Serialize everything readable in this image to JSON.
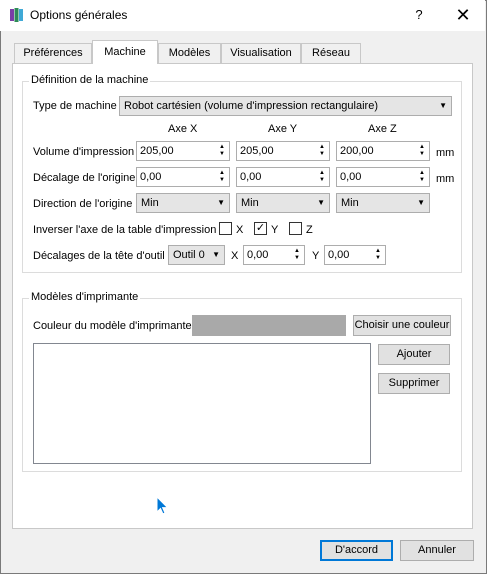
{
  "window": {
    "title": "Options générales",
    "help_label": "?",
    "close_label": "✕"
  },
  "tabs": [
    {
      "label": "Préférences"
    },
    {
      "label": "Machine"
    },
    {
      "label": "Modèles"
    },
    {
      "label": "Visualisation"
    },
    {
      "label": "Réseau"
    }
  ],
  "active_tab": "Machine",
  "machine": {
    "group_title": "Définition de la machine",
    "type_label": "Type de machine",
    "type_value": "Robot cartésien (volume d'impression rectangulaire)",
    "axis_headers": [
      "Axe X",
      "Axe Y",
      "Axe Z"
    ],
    "volume_label": "Volume d'impression",
    "volume_values": [
      "205,00",
      "205,00",
      "200,00"
    ],
    "volume_unit": "mm",
    "origin_offset_label": "Décalage de l'origine",
    "origin_offset_values": [
      "0,00",
      "0,00",
      "0,00"
    ],
    "origin_offset_unit": "mm",
    "origin_dir_label": "Direction de l'origine",
    "origin_dir_values": [
      "Min",
      "Min",
      "Min"
    ],
    "invert_label": "Inverser l'axe de la table d'impression",
    "invert_axes": [
      {
        "label": "X",
        "checked": false
      },
      {
        "label": "Y",
        "checked": true
      },
      {
        "label": "Z",
        "checked": false
      }
    ],
    "tool_offset_label": "Décalages de la tête d'outil",
    "tool_select_value": "Outil 0",
    "tool_x_label": "X",
    "tool_x_value": "0,00",
    "tool_y_label": "Y",
    "tool_y_value": "0,00"
  },
  "printer_models": {
    "group_title": "Modèles d'imprimante",
    "color_label": "Couleur du modèle d'imprimante",
    "color_value": "#a9a9a9",
    "choose_color_label": "Choisir une couleur",
    "add_label": "Ajouter",
    "delete_label": "Supprimer",
    "items": []
  },
  "footer": {
    "ok_label": "D'accord",
    "cancel_label": "Annuler"
  },
  "colors": {
    "accent": "#0078d7",
    "icon_colors": [
      "#7a3ea6",
      "#2e8b57",
      "#3fa9d6"
    ]
  }
}
